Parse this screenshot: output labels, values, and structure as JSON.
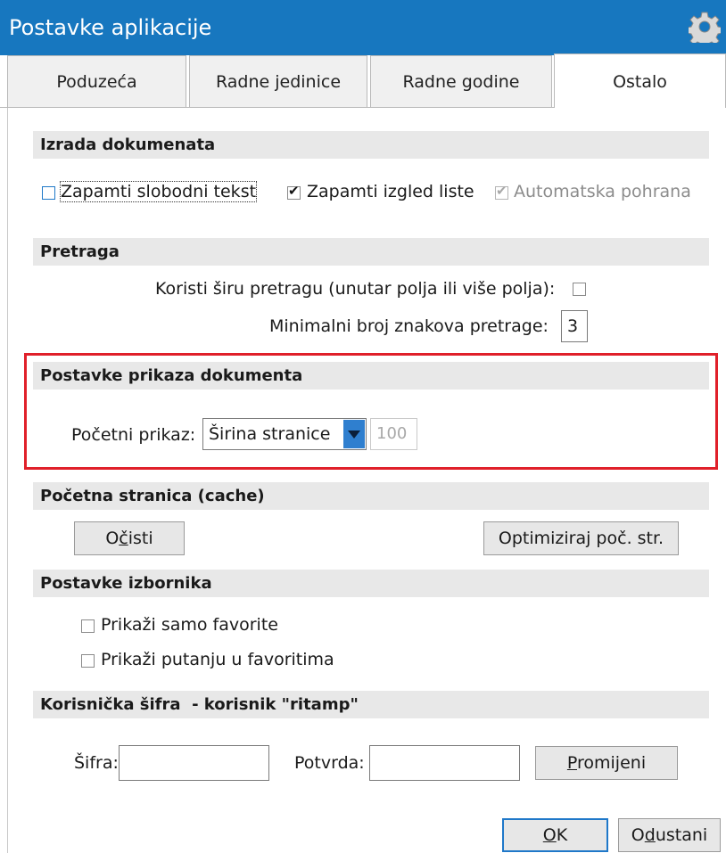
{
  "window": {
    "title": "Postavke aplikacije",
    "icon": "gear-icon"
  },
  "tabs": [
    {
      "label": "Poduzeća",
      "active": false
    },
    {
      "label": "Radne jedinice",
      "active": false
    },
    {
      "label": "Radne godine",
      "active": false
    },
    {
      "label": "Ostalo",
      "active": true
    }
  ],
  "izrada": {
    "title": "Izrada dokumenata",
    "slobodni_tekst": {
      "label": "Zapamti slobodni tekst",
      "checked": false
    },
    "izgled_liste": {
      "label": "Zapamti izgled liste",
      "checked": true
    },
    "auto_pohrana": {
      "label": "Automatska pohrana",
      "checked": true,
      "disabled": true
    }
  },
  "pretraga": {
    "title": "Pretraga",
    "sira_label": "Koristi širu pretragu (unutar polja ili više polja):",
    "sira_checked": false,
    "min_label": "Minimalni broj znakova pretrage:",
    "min_value": "3"
  },
  "prikaz": {
    "title": "Postavke prikaza dokumenta",
    "pocetni_label": "Početni prikaz:",
    "pocetni_value": "Širina stranice",
    "zoom_value": "100"
  },
  "cache": {
    "title": "Početna stranica (cache)",
    "ocisti_pre": "O",
    "ocisti_u": "č",
    "ocisti_post": "isti",
    "optimiziraj": "Optimiziraj poč. str."
  },
  "izbornik": {
    "title": "Postavke izbornika",
    "favoriti": {
      "label": "Prikaži samo favorite",
      "checked": false
    },
    "putanja": {
      "label": "Prikaži putanju u favoritima",
      "checked": false
    }
  },
  "sifra": {
    "title": "Korisnička šifra  - korisnik \"ritamp\"",
    "sifra_label": "Šifra:",
    "potvrda_label": "Potvrda:",
    "promijeni_u": "P",
    "promijeni_post": "romijeni"
  },
  "footer": {
    "ok_u": "O",
    "ok_post": "K",
    "odustani_pre": "O",
    "odustani_u": "d",
    "odustani_post": "ustani"
  },
  "colors": {
    "titlebar": "#1777bf",
    "highlight_border": "#e0202a",
    "primary_border": "#1f78c9"
  }
}
